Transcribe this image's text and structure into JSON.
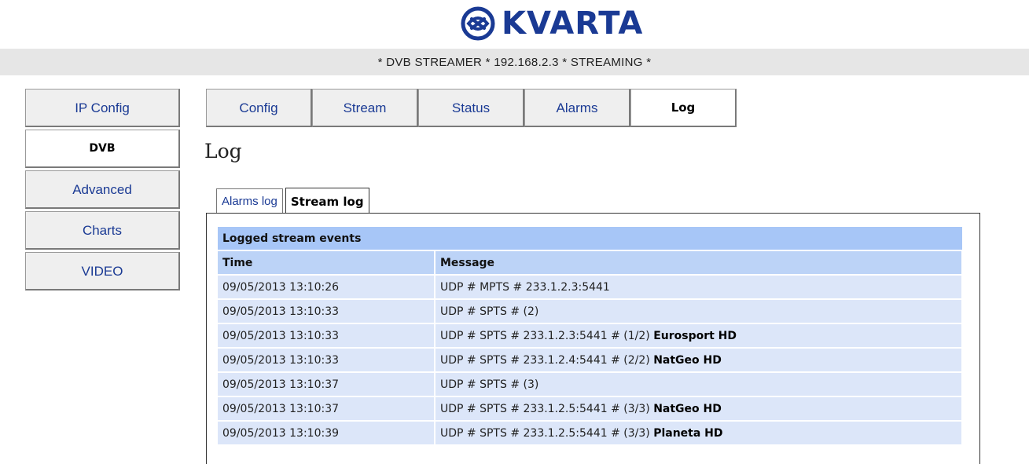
{
  "brand": {
    "name": "KVARTA",
    "color": "#1a3a94"
  },
  "status_line": "* DVB STREAMER * 192.168.2.3 * STREAMING *",
  "sidebar": {
    "items": [
      {
        "label": "IP Config",
        "active": false
      },
      {
        "label": "DVB",
        "active": true
      },
      {
        "label": "Advanced",
        "active": false
      },
      {
        "label": "Charts",
        "active": false
      },
      {
        "label": "VIDEO",
        "active": false
      }
    ]
  },
  "top_tabs": [
    {
      "label": "Config",
      "active": false
    },
    {
      "label": "Stream",
      "active": false
    },
    {
      "label": "Status",
      "active": false
    },
    {
      "label": "Alarms",
      "active": false
    },
    {
      "label": "Log",
      "active": true
    }
  ],
  "page_title": "Log",
  "sub_tabs": [
    {
      "label": "Alarms log",
      "active": false
    },
    {
      "label": "Stream log",
      "active": true
    }
  ],
  "table": {
    "caption": "Logged stream events",
    "columns": [
      "Time",
      "Message"
    ],
    "rows": [
      {
        "time": "09/05/2013 13:10:26",
        "message": "UDP # MPTS # 233.1.2.3:5441",
        "channel": ""
      },
      {
        "time": "09/05/2013 13:10:33",
        "message": "UDP # SPTS # (2)",
        "channel": ""
      },
      {
        "time": "09/05/2013 13:10:33",
        "message": "UDP # SPTS # 233.1.2.3:5441 # (1/2)",
        "channel": "Eurosport HD"
      },
      {
        "time": "09/05/2013 13:10:33",
        "message": "UDP # SPTS # 233.1.2.4:5441 # (2/2)",
        "channel": "NatGeo HD"
      },
      {
        "time": "09/05/2013 13:10:37",
        "message": "UDP # SPTS # (3)",
        "channel": ""
      },
      {
        "time": "09/05/2013 13:10:37",
        "message": "UDP # SPTS # 233.1.2.5:5441 # (3/3)",
        "channel": "NatGeo HD"
      },
      {
        "time": "09/05/2013 13:10:39",
        "message": "UDP # SPTS # 233.1.2.5:5441 # (3/3)",
        "channel": "Planeta HD"
      }
    ]
  }
}
